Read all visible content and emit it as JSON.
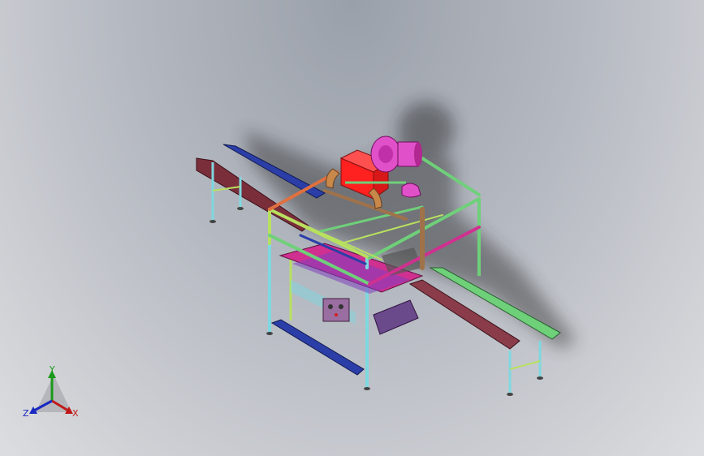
{
  "viewport": {
    "background_top": "#9aa0aa",
    "background_bottom": "#dcdde0"
  },
  "model": {
    "parts": {
      "conveyor_side_rail": "#7a2e3a",
      "conveyor_back_rail": "#8a3c4a",
      "frame_green": "#6fd07a",
      "frame_cyan": "#7fd8e0",
      "frame_yellow_green": "#b8e060",
      "frame_orange": "#e07040",
      "frame_magenta": "#d03090",
      "frame_purple": "#8040c0",
      "frame_blue": "#2b3ea8",
      "brown_beam": "#a0724a",
      "red_block": "#ff2020",
      "pink_fan": "#e050c8",
      "copper_pipe": "#c8884a",
      "control_panel": "#9a6ea0",
      "belt": "#6a4a8a"
    }
  },
  "triad": {
    "y_label": "Y",
    "x_label": "X",
    "z_label": "Z",
    "y_color": "#1a9a1a",
    "x_color": "#c01818",
    "z_color": "#1828c0"
  }
}
